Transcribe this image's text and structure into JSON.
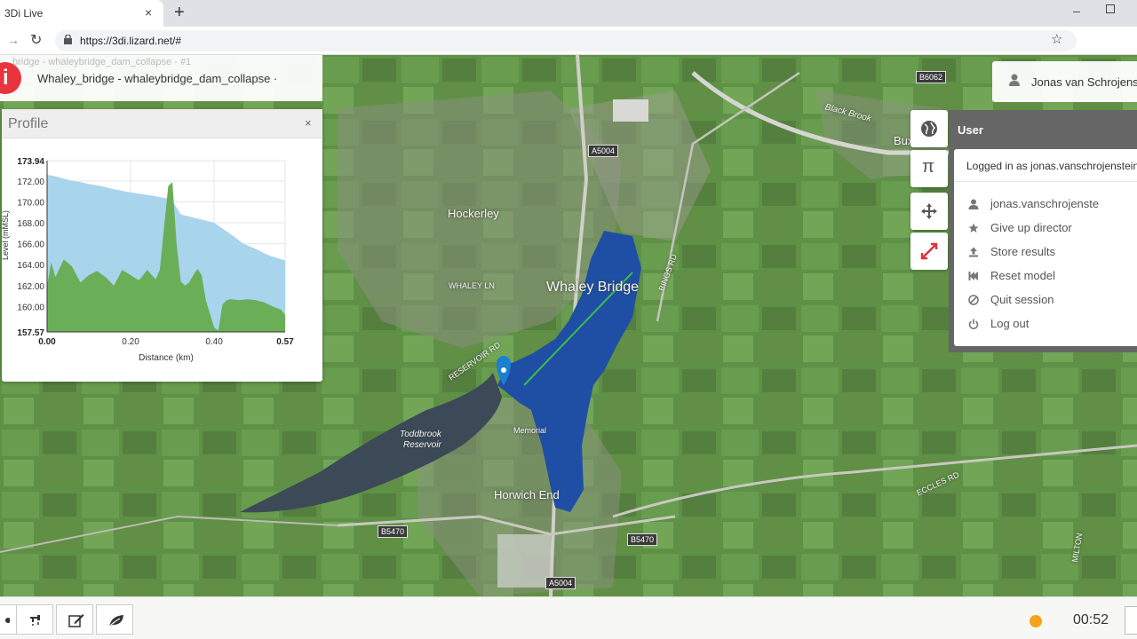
{
  "browser": {
    "tab_title": "3Di Live",
    "tab_close": "×",
    "new_tab": "+",
    "url": "https://3di.lizard.net/#",
    "minimize": "–"
  },
  "scenario": {
    "ghost_title": "bridge - whaleybridge_dam_collapse - #1",
    "title": "Whaley_bridge - whaleybridge_dam_collapse ·",
    "logo_glyph": "i"
  },
  "map": {
    "labels": {
      "hockerley": "Hockerley",
      "whaley_bridge": "Whaley Bridge",
      "buxworth": "Buxworth",
      "horwich_end": "Horwich End",
      "memorial": "Memorial",
      "toddbrook": "Toddbrook",
      "reservoir": "Reservoir",
      "whaley_ln": "WHALEY LN",
      "reservoir_rd": "RESERVOIR RD",
      "bings_rd": "BINGS RD",
      "eccles_rd": "ECCLES RD",
      "black_brook": "Black Brook",
      "milton": "MILTON"
    },
    "roads": {
      "a5004_top": "A5004",
      "a5004_bottom": "A5004",
      "b5470_left": "B5470",
      "b5470_right": "B5470",
      "b6062": "B6062"
    },
    "flood_color": "#1f4fa5",
    "profile_line_color": "#3dbb4a"
  },
  "profile": {
    "title": "Profile",
    "close": "×",
    "ylabel": "Level (mMSL)",
    "xlabel": "Distance (km)",
    "y_ticks": [
      "173.94",
      "172.00",
      "170.00",
      "168.00",
      "166.00",
      "164.00",
      "162.00",
      "160.00",
      "157.57"
    ],
    "x_ticks": [
      "0.00",
      "0.20",
      "0.40",
      "0.57"
    ]
  },
  "chart_data": {
    "type": "area",
    "title": "Profile",
    "xlabel": "Distance (km)",
    "ylabel": "Level (mMSL)",
    "xlim": [
      0,
      0.57
    ],
    "ylim": [
      157.57,
      173.94
    ],
    "series": [
      {
        "color": "#a8d4ec",
        "x": [
          0.0,
          0.025,
          0.05,
          0.08,
          0.1,
          0.13,
          0.16,
          0.2,
          0.25,
          0.29,
          0.3,
          0.32,
          0.36,
          0.4,
          0.44,
          0.47,
          0.5,
          0.53,
          0.57
        ],
        "y": [
          172.6,
          172.4,
          172.1,
          171.9,
          171.7,
          171.5,
          171.2,
          170.9,
          170.6,
          170.3,
          170.1,
          168.8,
          168.4,
          168.0,
          166.9,
          166.0,
          165.5,
          164.9,
          164.4
        ]
      },
      {
        "color": "#6aaf58",
        "x": [
          0.0,
          0.01,
          0.02,
          0.04,
          0.06,
          0.08,
          0.1,
          0.12,
          0.14,
          0.16,
          0.18,
          0.2,
          0.22,
          0.24,
          0.26,
          0.27,
          0.28,
          0.29,
          0.3,
          0.31,
          0.32,
          0.33,
          0.34,
          0.35,
          0.36,
          0.37,
          0.38,
          0.39,
          0.4,
          0.41,
          0.42,
          0.43,
          0.44,
          0.46,
          0.48,
          0.5,
          0.52,
          0.54,
          0.56,
          0.57
        ],
        "y": [
          162.0,
          164.2,
          162.8,
          164.5,
          163.8,
          162.3,
          163.0,
          163.4,
          162.8,
          162.0,
          163.5,
          163.0,
          162.5,
          163.5,
          162.6,
          163.5,
          167.5,
          171.5,
          171.9,
          166.0,
          162.4,
          162.0,
          162.3,
          163.0,
          163.6,
          163.0,
          160.6,
          159.3,
          158.0,
          157.7,
          160.2,
          160.6,
          160.7,
          160.6,
          160.7,
          160.6,
          160.4,
          160.0,
          159.7,
          159.2
        ]
      }
    ]
  },
  "tools": {
    "pi_glyph": "π"
  },
  "user": {
    "name_top": "Jonas van Schrojenstein",
    "panel_title": "User",
    "logged_in": "Logged in as jonas.vanschrojenstein",
    "menu": [
      {
        "icon": "user-icon",
        "label": "jonas.vanschrojenste"
      },
      {
        "icon": "star-icon",
        "label": "Give up director"
      },
      {
        "icon": "upload-icon",
        "label": "Store results"
      },
      {
        "icon": "reset-icon",
        "label": "Reset model"
      },
      {
        "icon": "ban-icon",
        "label": "Quit session"
      },
      {
        "icon": "power-icon",
        "label": "Log out"
      }
    ]
  },
  "bottom": {
    "status_color": "#f5a31a",
    "time": "00:52"
  }
}
